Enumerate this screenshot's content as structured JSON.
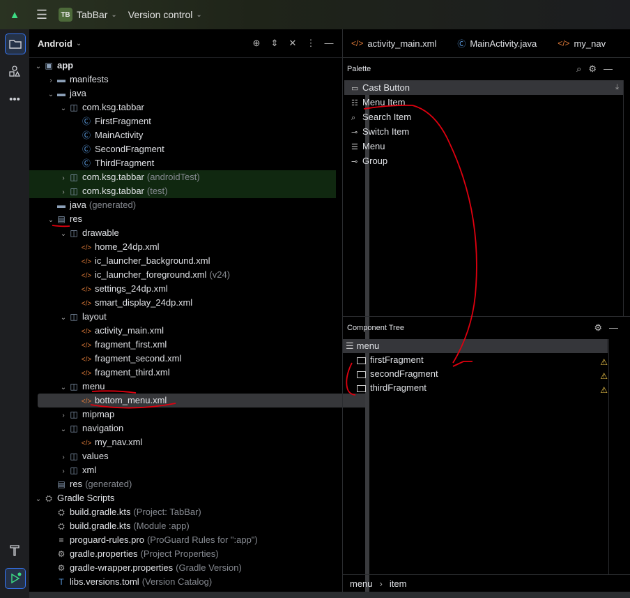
{
  "titlebar": {
    "project_badge": "TB",
    "project_name": "TabBar",
    "vcs_label": "Version control"
  },
  "project_panel": {
    "view_label": "Android",
    "tree": [
      {
        "depth": 0,
        "arrow": "down",
        "icon": "module-folder",
        "label": "app",
        "bold": true
      },
      {
        "depth": 1,
        "arrow": "right",
        "icon": "folder",
        "label": "manifests"
      },
      {
        "depth": 1,
        "arrow": "down",
        "icon": "folder",
        "label": "java"
      },
      {
        "depth": 2,
        "arrow": "down",
        "icon": "package",
        "label": "com.ksg.tabbar"
      },
      {
        "depth": 3,
        "arrow": "",
        "icon": "class",
        "label": "FirstFragment"
      },
      {
        "depth": 3,
        "arrow": "",
        "icon": "class",
        "label": "MainActivity"
      },
      {
        "depth": 3,
        "arrow": "",
        "icon": "class",
        "label": "SecondFragment"
      },
      {
        "depth": 3,
        "arrow": "",
        "icon": "class",
        "label": "ThirdFragment"
      },
      {
        "depth": 2,
        "arrow": "right",
        "icon": "package",
        "label": "com.ksg.tabbar",
        "suffix": "(androidTest)",
        "highlight": true
      },
      {
        "depth": 2,
        "arrow": "right",
        "icon": "package",
        "label": "com.ksg.tabbar",
        "suffix": "(test)",
        "highlight": true
      },
      {
        "depth": 1,
        "arrow": "",
        "icon": "folder",
        "label": "java",
        "suffix": "(generated)"
      },
      {
        "depth": 1,
        "arrow": "down",
        "icon": "res-folder",
        "label": "res"
      },
      {
        "depth": 2,
        "arrow": "down",
        "icon": "package",
        "label": "drawable"
      },
      {
        "depth": 3,
        "arrow": "",
        "icon": "xml",
        "label": "home_24dp.xml"
      },
      {
        "depth": 3,
        "arrow": "",
        "icon": "xml",
        "label": "ic_launcher_background.xml"
      },
      {
        "depth": 3,
        "arrow": "",
        "icon": "xml",
        "label": "ic_launcher_foreground.xml",
        "suffix": "(v24)"
      },
      {
        "depth": 3,
        "arrow": "",
        "icon": "xml",
        "label": "settings_24dp.xml"
      },
      {
        "depth": 3,
        "arrow": "",
        "icon": "xml",
        "label": "smart_display_24dp.xml"
      },
      {
        "depth": 2,
        "arrow": "down",
        "icon": "package",
        "label": "layout"
      },
      {
        "depth": 3,
        "arrow": "",
        "icon": "xml",
        "label": "activity_main.xml"
      },
      {
        "depth": 3,
        "arrow": "",
        "icon": "xml",
        "label": "fragment_first.xml"
      },
      {
        "depth": 3,
        "arrow": "",
        "icon": "xml",
        "label": "fragment_second.xml"
      },
      {
        "depth": 3,
        "arrow": "",
        "icon": "xml",
        "label": "fragment_third.xml"
      },
      {
        "depth": 2,
        "arrow": "down",
        "icon": "package",
        "label": "menu"
      },
      {
        "depth": 3,
        "arrow": "",
        "icon": "xml",
        "label": "bottom_menu.xml",
        "selected": true
      },
      {
        "depth": 2,
        "arrow": "right",
        "icon": "package",
        "label": "mipmap"
      },
      {
        "depth": 2,
        "arrow": "down",
        "icon": "package",
        "label": "navigation"
      },
      {
        "depth": 3,
        "arrow": "",
        "icon": "xml",
        "label": "my_nav.xml"
      },
      {
        "depth": 2,
        "arrow": "right",
        "icon": "package",
        "label": "values"
      },
      {
        "depth": 2,
        "arrow": "right",
        "icon": "package",
        "label": "xml"
      },
      {
        "depth": 1,
        "arrow": "",
        "icon": "res-folder",
        "label": "res",
        "suffix": "(generated)"
      },
      {
        "depth": 0,
        "arrow": "down",
        "icon": "gradle",
        "label": "Gradle Scripts"
      },
      {
        "depth": 1,
        "arrow": "",
        "icon": "gradle",
        "label": "build.gradle.kts",
        "suffix": "(Project: TabBar)"
      },
      {
        "depth": 1,
        "arrow": "",
        "icon": "gradle",
        "label": "build.gradle.kts",
        "suffix": "(Module :app)"
      },
      {
        "depth": 1,
        "arrow": "",
        "icon": "text-file",
        "label": "proguard-rules.pro",
        "suffix": "(ProGuard Rules for \":app\")"
      },
      {
        "depth": 1,
        "arrow": "",
        "icon": "settings-file",
        "label": "gradle.properties",
        "suffix": "(Project Properties)"
      },
      {
        "depth": 1,
        "arrow": "",
        "icon": "settings-file",
        "label": "gradle-wrapper.properties",
        "suffix": "(Gradle Version)"
      },
      {
        "depth": 1,
        "arrow": "",
        "icon": "toml-file",
        "label": "libs.versions.toml",
        "suffix": "(Version Catalog)"
      }
    ]
  },
  "editor_tabs": [
    {
      "icon": "xml",
      "label": "activity_main.xml"
    },
    {
      "icon": "class",
      "label": "MainActivity.java"
    },
    {
      "icon": "xml",
      "label": "my_nav"
    }
  ],
  "palette": {
    "title": "Palette",
    "items": [
      {
        "icon": "cast-icon",
        "label": "Cast Button"
      },
      {
        "icon": "menu-item-icon",
        "label": "Menu Item"
      },
      {
        "icon": "search-icon",
        "label": "Search Item"
      },
      {
        "icon": "switch-icon",
        "label": "Switch Item"
      },
      {
        "icon": "menu-icon",
        "label": "Menu"
      },
      {
        "icon": "group-icon",
        "label": "Group"
      }
    ]
  },
  "component_tree": {
    "title": "Component Tree",
    "root": "menu",
    "items": [
      {
        "label": "firstFragment",
        "warning": true
      },
      {
        "label": "secondFragment",
        "warning": true
      },
      {
        "label": "thirdFragment",
        "warning": true
      }
    ]
  },
  "status_bar": {
    "crumb_1": "menu",
    "crumb_2": "item"
  },
  "colors": {
    "annotation": "#e0000f",
    "warning": "#f2c94c",
    "accent": "#3574f0"
  }
}
